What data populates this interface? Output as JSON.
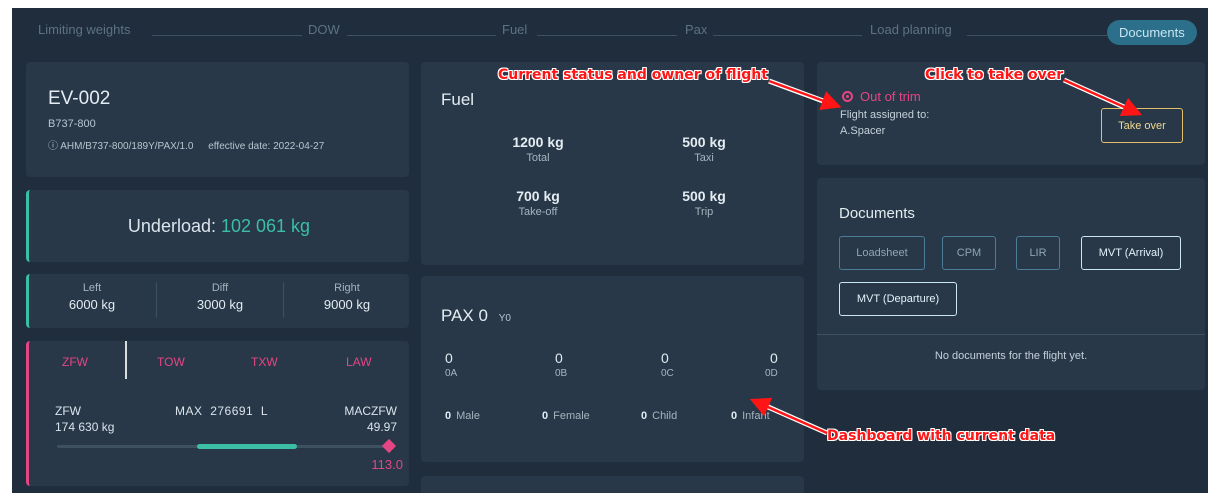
{
  "stepper": {
    "steps": [
      "Limiting weights",
      "DOW",
      "Fuel",
      "Pax",
      "Load planning",
      "Documents"
    ],
    "active": "Documents"
  },
  "flight": {
    "number": "EV-002",
    "aircraft": "B737-800",
    "ahm": "AHM/B737-800/189Y/PAX/1.0",
    "effective": "effective date: 2022-04-27"
  },
  "underload": {
    "label": "Underload:",
    "value": "102 061 kg"
  },
  "balance": [
    {
      "label": "Left",
      "value": "6000 kg"
    },
    {
      "label": "Diff",
      "value": "3000 kg"
    },
    {
      "label": "Right",
      "value": "9000 kg"
    }
  ],
  "weights": {
    "tabs": [
      "ZFW",
      "TOW",
      "TXW",
      "LAW"
    ],
    "current_label": "ZFW",
    "current_value": "174 630 kg",
    "max_label": "MAX",
    "max_value": "276691",
    "max_unit": "L",
    "mac_label": "MACZFW",
    "mac_value": "49.97",
    "slider_value": "113.0"
  },
  "fuel": {
    "title": "Fuel",
    "items": [
      {
        "value": "1200 kg",
        "label": "Total"
      },
      {
        "value": "500 kg",
        "label": "Taxi"
      },
      {
        "value": "700 kg",
        "label": "Take-off"
      },
      {
        "value": "500 kg",
        "label": "Trip"
      }
    ]
  },
  "pax": {
    "title": "PAX",
    "count": "0",
    "class": "Y0",
    "zones": [
      {
        "value": "0",
        "label": "0A"
      },
      {
        "value": "0",
        "label": "0B"
      },
      {
        "value": "0",
        "label": "0C"
      },
      {
        "value": "0",
        "label": "0D"
      }
    ],
    "genders": [
      {
        "value": "0",
        "label": "Male"
      },
      {
        "value": "0",
        "label": "Female"
      },
      {
        "value": "0",
        "label": "Child"
      },
      {
        "value": "0",
        "label": "Infant"
      }
    ]
  },
  "status": {
    "text": "Out of trim",
    "assigned_label": "Flight assigned to:",
    "assigned_user": "A.Spacer",
    "take_over_label": "Take over"
  },
  "documents": {
    "title": "Documents",
    "buttons": [
      "Loadsheet",
      "CPM",
      "LIR",
      "MVT (Arrival)",
      "MVT (Departure)"
    ],
    "empty": "No documents for the flight yet."
  },
  "annotations": {
    "status": "Current status and owner of flight",
    "takeover": "Click to take over",
    "dashboard": "Dashboard with current data"
  },
  "colors": {
    "background": "#1f2d3c",
    "card": "#283848",
    "accent_green": "#3bbfa5",
    "accent_pink": "#e64584",
    "active_step": "#2b6f8a",
    "take_over_border": "#e4c06a",
    "annotation": "#ff1515"
  }
}
